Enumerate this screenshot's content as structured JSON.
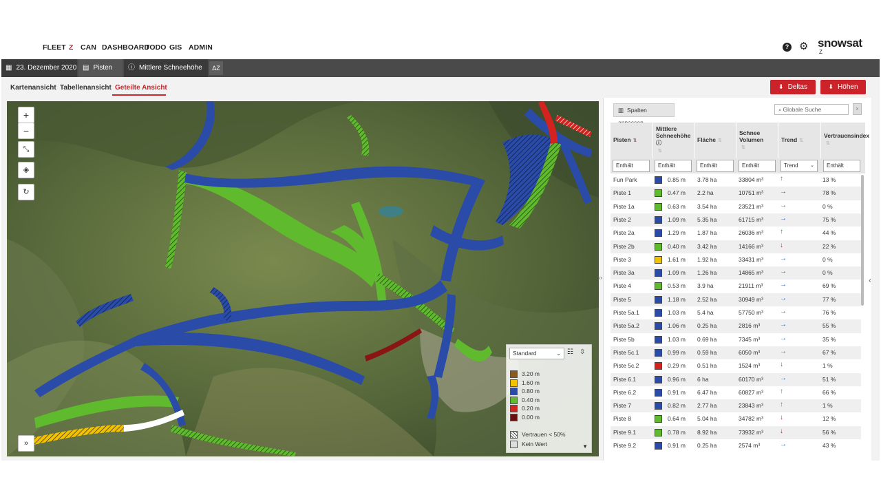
{
  "nav": {
    "items": [
      "FLEET",
      "Z",
      "CAN",
      "DASHBOARD",
      "TODO",
      "GIS",
      "ADMIN"
    ],
    "active": "Z",
    "logo": "snowsat",
    "logo_sub": "Z"
  },
  "toolbar": {
    "date": "23. Dezember 2020",
    "pisten": "Pisten",
    "metric": "Mittlere Schneehöhe",
    "delta": "ΔZ"
  },
  "view_tabs": [
    "Kartenansicht",
    "Tabellenansicht",
    "Geteilte Ansicht"
  ],
  "view_tab_active": "Geteilte Ansicht",
  "buttons": {
    "deltas": "Deltas",
    "hoehen": "Höhen"
  },
  "map": {
    "zoom_in": "+",
    "zoom_out": "−",
    "expand_toggle": "»",
    "legend": {
      "select_value": "Standard",
      "items": [
        {
          "label": "3.20 m",
          "color": "#8b5a1e"
        },
        {
          "label": "1.60 m",
          "color": "#f2c200"
        },
        {
          "label": "0.80 m",
          "color": "#2a4ca8"
        },
        {
          "label": "0.40 m",
          "color": "#5fba2e"
        },
        {
          "label": "0.20 m",
          "color": "#d4231f"
        },
        {
          "label": "0.00 m",
          "color": "#6a1010"
        }
      ],
      "vertrauen": "Vertrauen < 50%",
      "kein_wert": "Kein Wert"
    }
  },
  "table": {
    "spalten_label": "Spalten anpassen",
    "search_placeholder": "Globale Suche",
    "headers": [
      "Pisten",
      "Mittlere Schneehöhe",
      "Fläche",
      "Schnee Volumen",
      "Trend",
      "Vertrauensindex"
    ],
    "filters": [
      "Enthält",
      "Enthält",
      "Enthält",
      "Enthält",
      "Trend",
      "Enthält"
    ],
    "rows": [
      {
        "name": "Fun Park",
        "color": "#2a4ca8",
        "height": "0.85 m",
        "area": "3.78 ha",
        "volume": "33804 m³",
        "trend": "up",
        "conf": "13 %"
      },
      {
        "name": "Piste 1",
        "color": "#5fba2e",
        "height": "0.47 m",
        "area": "2.2 ha",
        "volume": "10751 m³",
        "trend": "right",
        "conf": "78 %"
      },
      {
        "name": "Piste 1a",
        "color": "#5fba2e",
        "height": "0.63 m",
        "area": "3.54 ha",
        "volume": "23521 m³",
        "trend": "right",
        "conf": "0 %"
      },
      {
        "name": "Piste 2",
        "color": "#2a4ca8",
        "height": "1.09 m",
        "area": "5.35 ha",
        "volume": "61715 m³",
        "trend": "right",
        "conf": "75 %"
      },
      {
        "name": "Piste 2a",
        "color": "#2a4ca8",
        "height": "1.29 m",
        "area": "1.87 ha",
        "volume": "26036 m³",
        "trend": "up",
        "conf": "44 %"
      },
      {
        "name": "Piste 2b",
        "color": "#5fba2e",
        "height": "0.40 m",
        "area": "3.42 ha",
        "volume": "14166 m³",
        "trend": "down",
        "conf": "22 %"
      },
      {
        "name": "Piste 3",
        "color": "#f2c200",
        "height": "1.61 m",
        "area": "1.92 ha",
        "volume": "33431 m³",
        "trend": "right",
        "conf": "0 %"
      },
      {
        "name": "Piste 3a",
        "color": "#2a4ca8",
        "height": "1.09 m",
        "area": "1.26 ha",
        "volume": "14865 m³",
        "trend": "right",
        "conf": "0 %"
      },
      {
        "name": "Piste 4",
        "color": "#5fba2e",
        "height": "0.53 m",
        "area": "3.9 ha",
        "volume": "21911 m³",
        "trend": "right",
        "conf": "69 %"
      },
      {
        "name": "Piste 5",
        "color": "#2a4ca8",
        "height": "1.18 m",
        "area": "2.52 ha",
        "volume": "30949 m³",
        "trend": "right",
        "conf": "77 %"
      },
      {
        "name": "Piste 5a.1",
        "color": "#2a4ca8",
        "height": "1.03 m",
        "area": "5.4 ha",
        "volume": "57750 m³",
        "trend": "right",
        "conf": "76 %"
      },
      {
        "name": "Piste 5a.2",
        "color": "#2a4ca8",
        "height": "1.06 m",
        "area": "0.25 ha",
        "volume": "2816 m³",
        "trend": "right",
        "conf": "55 %"
      },
      {
        "name": "Piste 5b",
        "color": "#2a4ca8",
        "height": "1.03 m",
        "area": "0.69 ha",
        "volume": "7345 m³",
        "trend": "right",
        "conf": "35 %"
      },
      {
        "name": "Piste 5c.1",
        "color": "#2a4ca8",
        "height": "0.99 m",
        "area": "0.59 ha",
        "volume": "6050 m³",
        "trend": "right",
        "conf": "67 %"
      },
      {
        "name": "Piste 5c.2",
        "color": "#d4231f",
        "height": "0.29 m",
        "area": "0.51 ha",
        "volume": "1524 m³",
        "trend": "down",
        "conf": "1 %"
      },
      {
        "name": "Piste 6.1",
        "color": "#2a4ca8",
        "height": "0.96 m",
        "area": "6 ha",
        "volume": "60170 m³",
        "trend": "right",
        "conf": "51 %"
      },
      {
        "name": "Piste 6.2",
        "color": "#2a4ca8",
        "height": "0.91 m",
        "area": "6.47 ha",
        "volume": "60827 m³",
        "trend": "up",
        "conf": "66 %"
      },
      {
        "name": "Piste 7",
        "color": "#2a4ca8",
        "height": "0.82 m",
        "area": "2.77 ha",
        "volume": "23843 m³",
        "trend": "up",
        "conf": "1 %"
      },
      {
        "name": "Piste 8",
        "color": "#5fba2e",
        "height": "0.64 m",
        "area": "5.04 ha",
        "volume": "34782 m³",
        "trend": "down",
        "conf": "12 %"
      },
      {
        "name": "Piste 9.1",
        "color": "#5fba2e",
        "height": "0.78 m",
        "area": "8.92 ha",
        "volume": "73932 m³",
        "trend": "down",
        "conf": "56 %"
      },
      {
        "name": "Piste 9.2",
        "color": "#2a4ca8",
        "height": "0.91 m",
        "area": "0.25 ha",
        "volume": "2574 m³",
        "trend": "right",
        "conf": "43 %"
      }
    ]
  }
}
